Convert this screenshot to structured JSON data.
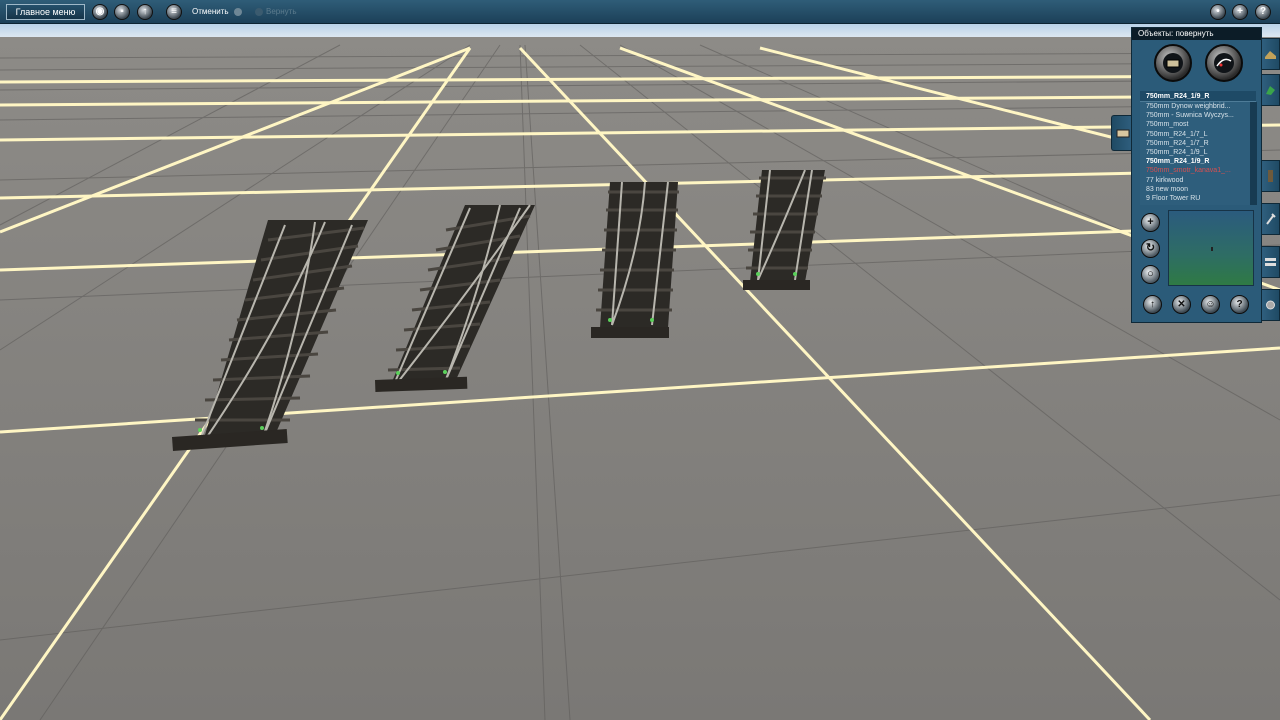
{
  "toolbar": {
    "main_menu_label": "Главное меню",
    "undo_label": "Отменить",
    "redo_label": "Вернуть",
    "left_icons": [
      "globe-icon",
      "trash-icon",
      "tool-icon",
      "list-icon"
    ],
    "right_icons": [
      "camera-icon",
      "plus-icon",
      "help-icon"
    ]
  },
  "panel": {
    "title": "Объекты: повернуть",
    "selected_object": "750mm_R24_1/9_R",
    "items": [
      {
        "label": "750mm Dynow weighbrid...",
        "state": "normal"
      },
      {
        "label": "750mm - Suwnica Wyczys...",
        "state": "normal"
      },
      {
        "label": "750mm_most",
        "state": "normal"
      },
      {
        "label": "750mm_R24_1/7_L",
        "state": "normal"
      },
      {
        "label": "750mm_R24_1/7_R",
        "state": "normal"
      },
      {
        "label": "750mm_R24_1/9_L",
        "state": "normal"
      },
      {
        "label": "750mm_R24_1/9_R",
        "state": "selected"
      },
      {
        "label": "750mm_smotr_kanava1_...",
        "state": "highlight"
      },
      {
        "label": "77 kirkwood",
        "state": "normal"
      },
      {
        "label": "83 new moon",
        "state": "normal"
      },
      {
        "label": "9 Floor Tower RU",
        "state": "normal"
      }
    ],
    "mode_buttons": [
      "object-mode-icon",
      "rotate-mode-icon"
    ],
    "side_buttons": [
      "add-icon",
      "rotate-icon",
      "reset-rotation-icon"
    ],
    "bottom_buttons": [
      "get-object-icon",
      "delete-icon",
      "person-icon",
      "help-icon"
    ],
    "side_tabs": [
      "terrain-tab-icon",
      "objects-tab-icon",
      "track-tab-icon",
      "tools-tab-icon",
      "layers-tab-icon",
      "settings-tab-icon"
    ]
  },
  "colors": {
    "panel_bg": "#2b5b79",
    "toolbar_bg": "#2f5d78",
    "ground": "#7d7b78",
    "grid_major": "#fff6c4",
    "list_highlight": "#d85050"
  }
}
